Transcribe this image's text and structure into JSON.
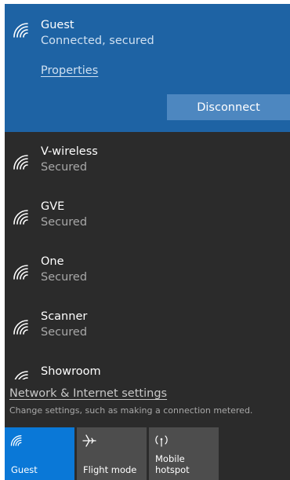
{
  "connected": {
    "name": "Guest",
    "status": "Connected, secured",
    "properties_label": "Properties",
    "disconnect_label": "Disconnect",
    "icon": "wifi-icon"
  },
  "networks": [
    {
      "name": "V-wireless",
      "status": "Secured",
      "icon": "wifi-icon"
    },
    {
      "name": "GVE",
      "status": "Secured",
      "icon": "wifi-icon"
    },
    {
      "name": "One",
      "status": "Secured",
      "icon": "wifi-icon"
    },
    {
      "name": "Scanner",
      "status": "Secured",
      "icon": "wifi-icon"
    },
    {
      "name": "Showroom",
      "status": "",
      "icon": "wifi-icon"
    }
  ],
  "settings": {
    "link_label": "Network & Internet settings",
    "description": "Change settings, such as making a connection metered."
  },
  "quick_actions": [
    {
      "label": "Guest",
      "icon": "wifi-icon",
      "active": true
    },
    {
      "label": "Flight mode",
      "icon": "airplane-icon",
      "active": false
    },
    {
      "label_line1": "Mobile",
      "label_line2": "hotspot",
      "icon": "mobile-hotspot-icon",
      "active": false
    }
  ],
  "colors": {
    "accent": "#0a78d7",
    "connected_bg": "#1e63a4",
    "panel_bg": "#2b2b2b",
    "disconnect_button": "#4d87c0"
  }
}
